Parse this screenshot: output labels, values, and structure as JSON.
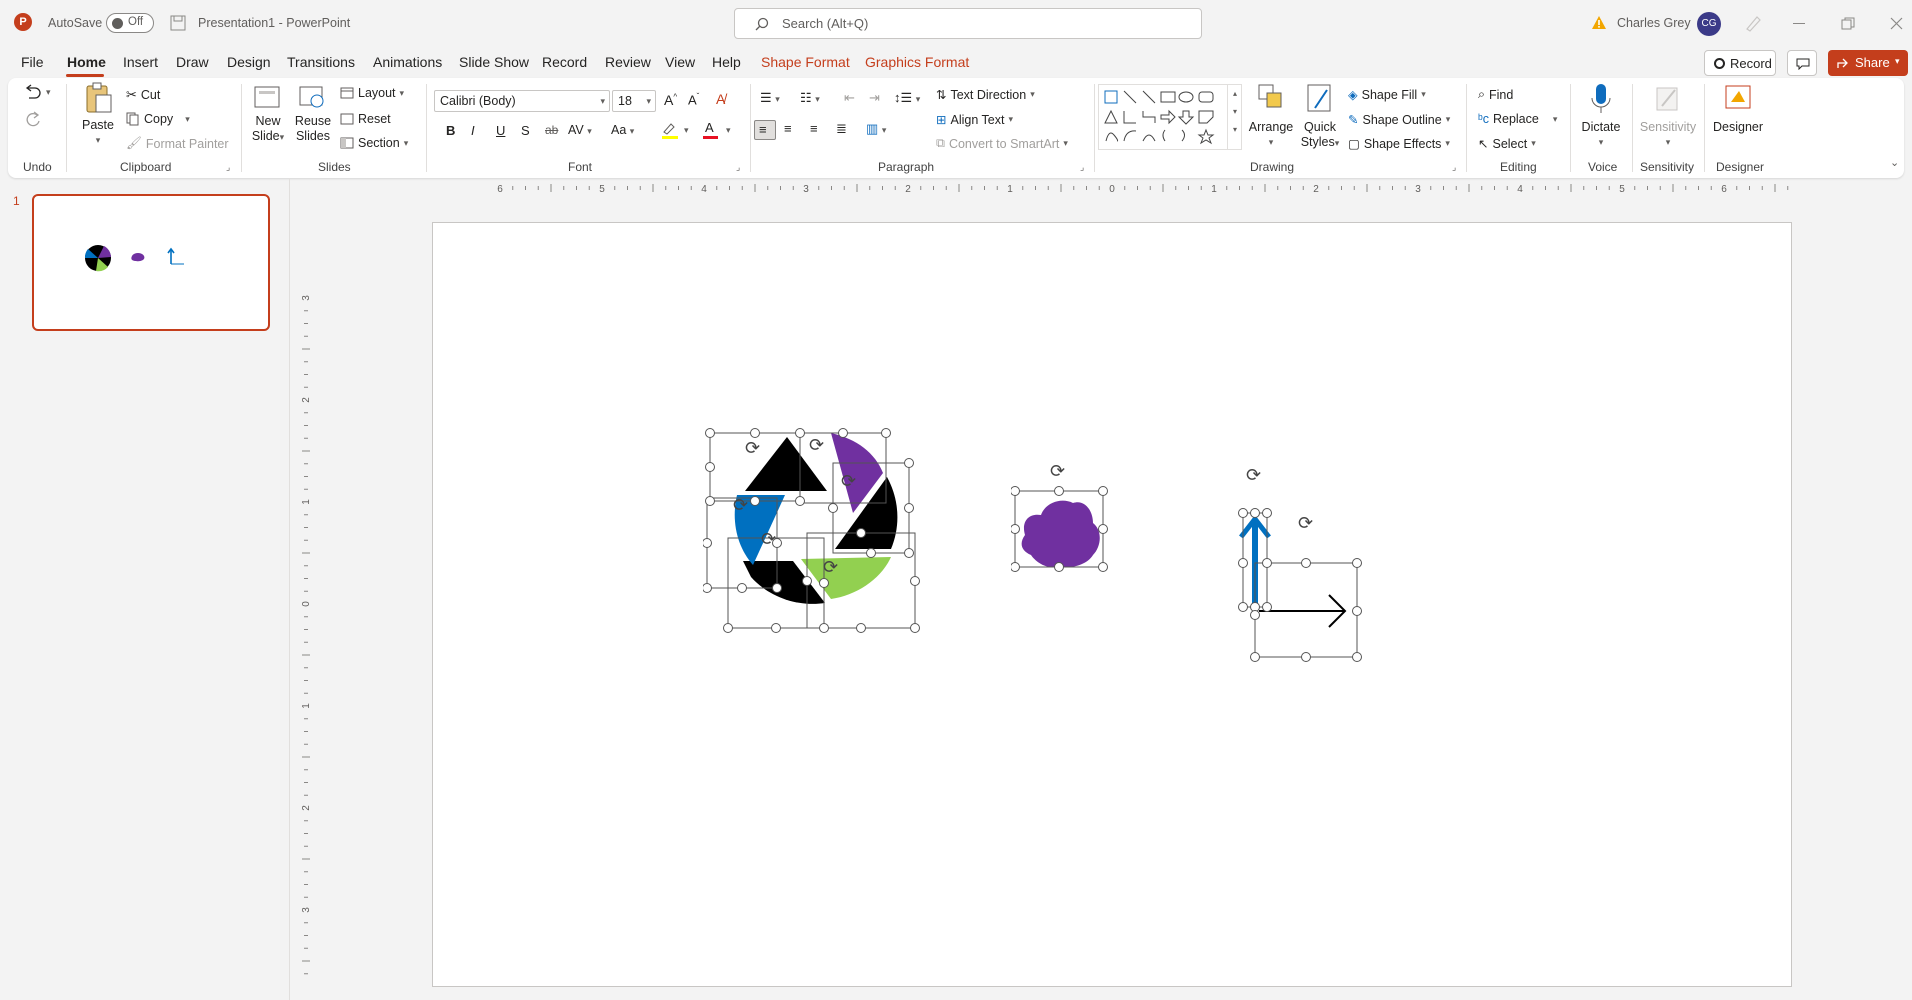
{
  "app": {
    "autosave_label": "AutoSave",
    "autosave_state": "Off",
    "doc_title": "Presentation1 - PowerPoint",
    "search_placeholder": "Search (Alt+Q)",
    "user_name": "Charles Grey",
    "user_initials": "CG"
  },
  "tabs": [
    "File",
    "Home",
    "Insert",
    "Draw",
    "Design",
    "Transitions",
    "Animations",
    "Slide Show",
    "Record",
    "Review",
    "View",
    "Help",
    "Shape Format",
    "Graphics Format"
  ],
  "actions": {
    "record": "Record",
    "share": "Share"
  },
  "ribbon": {
    "undo_group": "Undo",
    "clipboard": {
      "paste": "Paste",
      "cut": "Cut",
      "copy": "Copy",
      "format_painter": "Format Painter",
      "label": "Clipboard"
    },
    "slides": {
      "new_slide_1": "New",
      "new_slide_2": "Slide",
      "reuse_1": "Reuse",
      "reuse_2": "Slides",
      "layout": "Layout",
      "reset": "Reset",
      "section": "Section",
      "label": "Slides"
    },
    "font": {
      "name": "Calibri (Body)",
      "size": "18",
      "label": "Font"
    },
    "paragraph": {
      "text_direction": "Text Direction",
      "align_text": "Align Text",
      "convert_smartart": "Convert to SmartArt",
      "label": "Paragraph"
    },
    "drawing": {
      "arrange": "Arrange",
      "quick_1": "Quick",
      "quick_2": "Styles",
      "shape_fill": "Shape Fill",
      "shape_outline": "Shape Outline",
      "shape_effects": "Shape Effects",
      "label": "Drawing"
    },
    "editing": {
      "find": "Find",
      "replace": "Replace",
      "select": "Select",
      "label": "Editing"
    },
    "voice": {
      "dictate": "Dictate",
      "label": "Voice"
    },
    "sensitivity": {
      "button": "Sensitivity",
      "label": "Sensitivity"
    },
    "designer": {
      "button": "Designer",
      "label": "Designer"
    }
  },
  "thumbnails": [
    {
      "number": "1"
    }
  ],
  "ruler": {
    "h": [
      "6",
      "5",
      "4",
      "3",
      "2",
      "1",
      "0",
      "1",
      "2",
      "3",
      "4",
      "5",
      "6"
    ],
    "v": [
      "3",
      "2",
      "1",
      "0",
      "1",
      "2",
      "3"
    ]
  },
  "colors": {
    "accent": "#c43e1c",
    "purple": "#7030a0",
    "blue": "#0070c0",
    "green": "#92d050",
    "black": "#000000"
  }
}
